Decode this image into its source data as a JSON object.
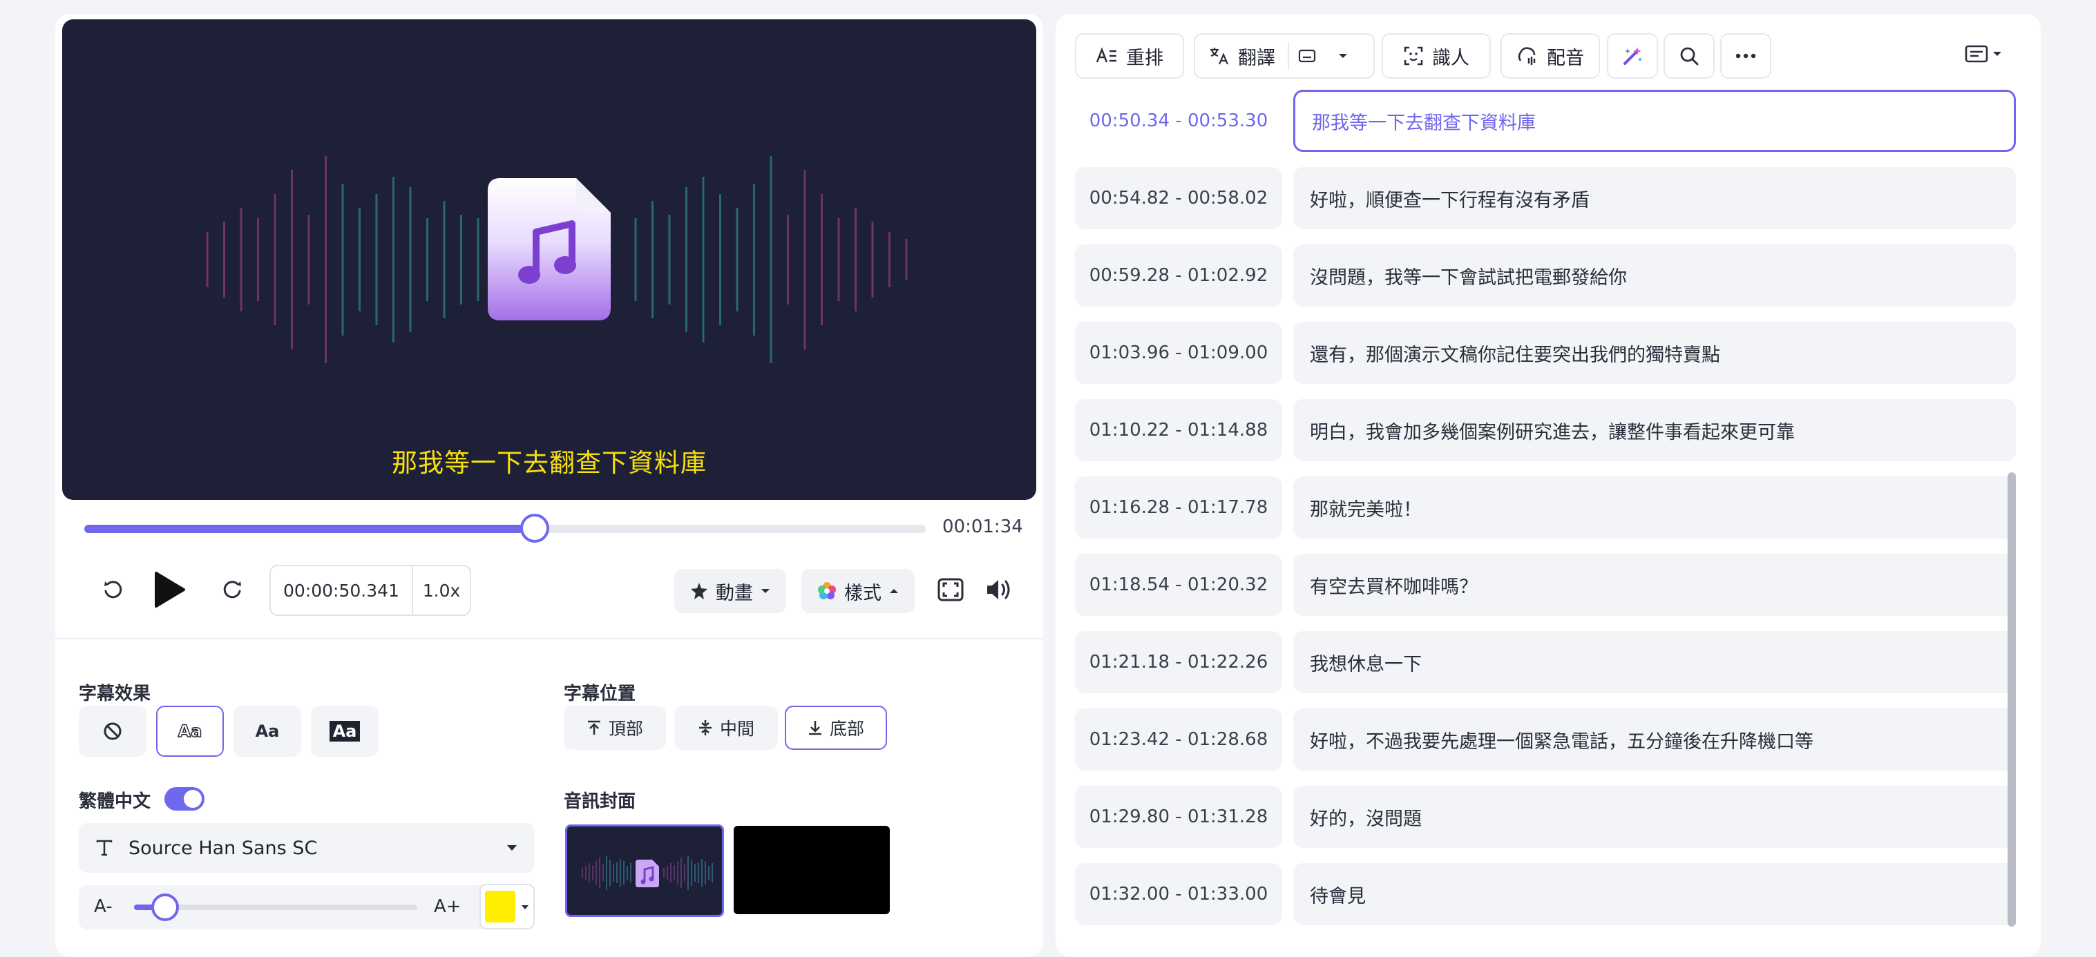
{
  "player": {
    "subtitle": "那我等一下去翻查下資料庫",
    "duration": "00:01:34",
    "progress_fraction": 0.535,
    "current_time": "00:00:50.341",
    "speed": "1.0x",
    "animation_label": "動畫",
    "style_label": "樣式"
  },
  "settings": {
    "effects_label": "字幕效果",
    "position_label": "字幕位置",
    "position_top": "頂部",
    "position_middle": "中間",
    "position_bottom": "底部",
    "effect_aa_outline": "Aa",
    "effect_aa_plain": "Aa",
    "effect_aa_box": "Aa",
    "language_label": "繁體中文",
    "font_name": "Source Han Sans SC",
    "size_minus": "A-",
    "size_plus": "A+",
    "size_fraction": 0.11,
    "subtitle_color": "#ffee00",
    "cover_label": "音訊封面"
  },
  "toolbar": {
    "rearrange": "重排",
    "translate": "翻譯",
    "identify": "識人",
    "dub": "配音"
  },
  "transcript": [
    {
      "time": "00:50.34 - 00:53.30",
      "text": "那我等一下去翻查下資料庫",
      "active": true
    },
    {
      "time": "00:54.82 - 00:58.02",
      "text": "好啦，順便查一下行程有沒有矛盾"
    },
    {
      "time": "00:59.28 - 01:02.92",
      "text": "沒問題，我等一下會試試把電郵發給你"
    },
    {
      "time": "01:03.96 - 01:09.00",
      "text": "還有，那個演示文稿你記住要突出我們的獨特賣點"
    },
    {
      "time": "01:10.22 - 01:14.88",
      "text": "明白，我會加多幾個案例研究進去，讓整件事看起來更可靠"
    },
    {
      "time": "01:16.28 - 01:17.78",
      "text": "那就完美啦！"
    },
    {
      "time": "01:18.54 - 01:20.32",
      "text": "有空去買杯咖啡嗎？"
    },
    {
      "time": "01:21.18 - 01:22.26",
      "text": "我想休息一下"
    },
    {
      "time": "01:23.42 - 01:28.68",
      "text": "好啦，不過我要先處理一個緊急電話，五分鐘後在升降機口等"
    },
    {
      "time": "01:29.80 - 01:31.28",
      "text": "好的，沒問題"
    },
    {
      "time": "01:32.00 - 01:33.00",
      "text": "待會見"
    }
  ]
}
